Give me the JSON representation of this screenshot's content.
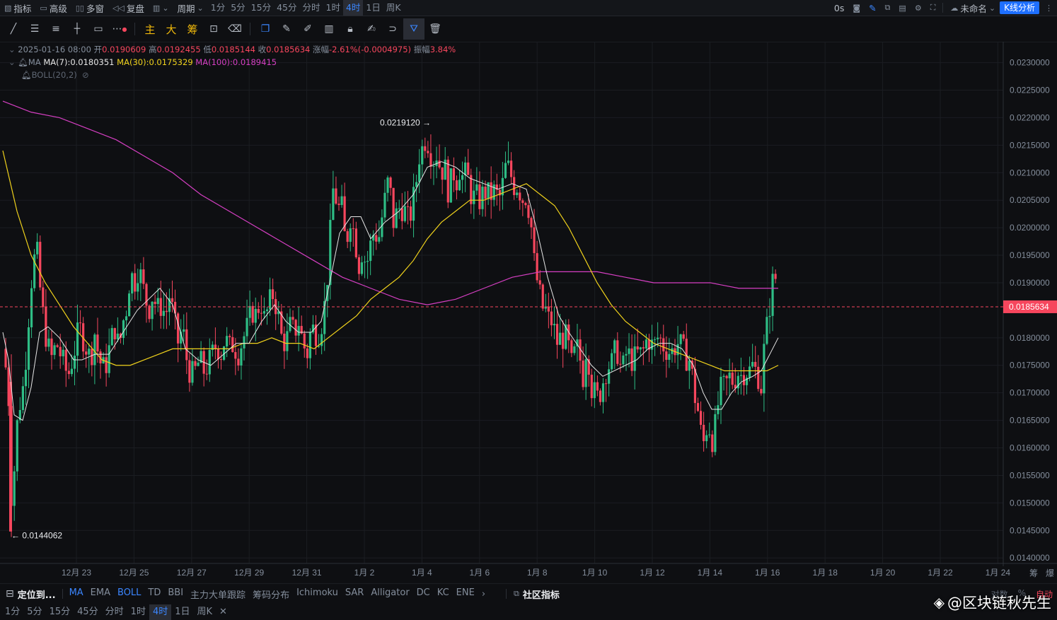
{
  "topbar": {
    "indicators": "指标",
    "advanced": "高级",
    "multi_window": "多窗",
    "replay": "复盘",
    "period": "周期",
    "timeframes": [
      "1分",
      "5分",
      "15分",
      "45分",
      "分时",
      "1时",
      "4时",
      "1日",
      "周K"
    ],
    "active_timeframe": "4时",
    "countdown": "0s",
    "layout_name": "未命名",
    "kline_analysis": "K线分析"
  },
  "info": {
    "date": "2025-01-16 08:00",
    "open_label": "开",
    "open": "0.0190609",
    "high_label": "高",
    "high": "0.0192455",
    "low_label": "低",
    "low": "0.0185144",
    "close_label": "收",
    "close": "0.0185634",
    "change_label": "涨幅",
    "change": "-2.61%(-0.0004975)",
    "amplitude_label": "振幅",
    "amplitude": "3.84%",
    "ma_label": "MA",
    "ma7": "MA(7):0.0180351",
    "ma30": "MA(30):0.0175329",
    "ma100": "MA(100):0.0189415",
    "boll": "BOLL(20,2)"
  },
  "chart_data": {
    "type": "candlestick",
    "y_ticks": [
      "0.0230000",
      "0.0225000",
      "0.0220000",
      "0.0215000",
      "0.0210000",
      "0.0205000",
      "0.0200000",
      "0.0195000",
      "0.0190000",
      "0.0180000",
      "0.0175000",
      "0.0170000",
      "0.0165000",
      "0.0160000",
      "0.0155000",
      "0.0150000",
      "0.0145000",
      "0.0140000"
    ],
    "ylim": [
      0.0139,
      0.0232
    ],
    "x_ticks": [
      "12月 23",
      "12月 25",
      "12月 27",
      "12月 29",
      "12月 31",
      "1月 2",
      "1月 4",
      "1月 6",
      "1月 8",
      "1月 10",
      "1月 12",
      "1月 14",
      "1月 16",
      "1月 18",
      "1月 20",
      "1月 22",
      "1月 24"
    ],
    "last_price": "0.0185634",
    "max_label": "0.0219120",
    "min_label": "0.0144062",
    "colors": {
      "up": "#2ebd85",
      "down": "#f6465d",
      "ma7": "#e6e6e6",
      "ma30": "#f0d21c",
      "ma100": "#d63fc3"
    },
    "close_path": [
      [
        0,
        0.0178
      ],
      [
        6,
        0.0173
      ],
      [
        10,
        0.0165
      ],
      [
        13,
        0.0146
      ],
      [
        18,
        0.0162
      ],
      [
        24,
        0.0168
      ],
      [
        30,
        0.0172
      ],
      [
        36,
        0.0183
      ],
      [
        42,
        0.0193
      ],
      [
        48,
        0.0196
      ],
      [
        54,
        0.0187
      ],
      [
        60,
        0.0181
      ],
      [
        68,
        0.0176
      ],
      [
        76,
        0.0179
      ],
      [
        84,
        0.0176
      ],
      [
        92,
        0.0173
      ],
      [
        100,
        0.0177
      ],
      [
        108,
        0.0182
      ],
      [
        116,
        0.0179
      ],
      [
        124,
        0.0176
      ],
      [
        130,
        0.0181
      ],
      [
        136,
        0.0176
      ],
      [
        144,
        0.0174
      ],
      [
        152,
        0.0179
      ],
      [
        158,
        0.0182
      ],
      [
        164,
        0.0178
      ],
      [
        170,
        0.0183
      ],
      [
        176,
        0.0186
      ],
      [
        180,
        0.0192
      ],
      [
        186,
        0.019
      ],
      [
        192,
        0.0193
      ],
      [
        200,
        0.0188
      ],
      [
        206,
        0.0185
      ],
      [
        212,
        0.0188
      ],
      [
        218,
        0.0185
      ],
      [
        224,
        0.0186
      ],
      [
        230,
        0.0184
      ],
      [
        236,
        0.0188
      ],
      [
        242,
        0.0183
      ],
      [
        248,
        0.0179
      ],
      [
        254,
        0.0182
      ],
      [
        260,
        0.0176
      ],
      [
        266,
        0.0173
      ],
      [
        272,
        0.0174
      ],
      [
        278,
        0.0176
      ],
      [
        284,
        0.0174
      ],
      [
        290,
        0.0175
      ],
      [
        296,
        0.0177
      ],
      [
        302,
        0.0179
      ],
      [
        308,
        0.0177
      ],
      [
        314,
        0.018
      ],
      [
        320,
        0.0178
      ],
      [
        326,
        0.0179
      ],
      [
        332,
        0.0177
      ],
      [
        340,
        0.018
      ],
      [
        346,
        0.0182
      ],
      [
        352,
        0.0185
      ],
      [
        358,
        0.0184
      ],
      [
        364,
        0.0187
      ],
      [
        370,
        0.0183
      ],
      [
        376,
        0.0186
      ],
      [
        382,
        0.0188
      ],
      [
        388,
        0.0185
      ],
      [
        394,
        0.018
      ],
      [
        400,
        0.0179
      ],
      [
        406,
        0.0182
      ],
      [
        412,
        0.0181
      ],
      [
        418,
        0.0183
      ],
      [
        424,
        0.0179
      ],
      [
        430,
        0.0177
      ],
      [
        436,
        0.0182
      ],
      [
        442,
        0.0181
      ],
      [
        448,
        0.0181
      ],
      [
        454,
        0.0185
      ],
      [
        458,
        0.019
      ],
      [
        462,
        0.0197
      ],
      [
        466,
        0.0207
      ],
      [
        470,
        0.0206
      ],
      [
        474,
        0.0203
      ],
      [
        478,
        0.0205
      ],
      [
        482,
        0.0199
      ],
      [
        486,
        0.0197
      ],
      [
        490,
        0.0203
      ],
      [
        494,
        0.02
      ],
      [
        498,
        0.0199
      ],
      [
        502,
        0.0192
      ],
      [
        506,
        0.0196
      ],
      [
        510,
        0.0195
      ],
      [
        514,
        0.0193
      ],
      [
        518,
        0.0196
      ],
      [
        522,
        0.0198
      ],
      [
        526,
        0.02
      ],
      [
        530,
        0.0197
      ],
      [
        536,
        0.0202
      ],
      [
        540,
        0.0205
      ],
      [
        544,
        0.0208
      ],
      [
        548,
        0.0206
      ],
      [
        552,
        0.0201
      ],
      [
        558,
        0.0203
      ],
      [
        562,
        0.0204
      ],
      [
        568,
        0.0203
      ],
      [
        574,
        0.0201
      ],
      [
        580,
        0.0205
      ],
      [
        584,
        0.0208
      ],
      [
        588,
        0.0213
      ],
      [
        592,
        0.0214
      ],
      [
        596,
        0.0216
      ],
      [
        600,
        0.0216
      ],
      [
        604,
        0.0214
      ],
      [
        608,
        0.0212
      ],
      [
        612,
        0.0214
      ],
      [
        616,
        0.0212
      ],
      [
        620,
        0.021
      ],
      [
        624,
        0.0212
      ],
      [
        628,
        0.0207
      ],
      [
        632,
        0.0207
      ],
      [
        636,
        0.0211
      ],
      [
        640,
        0.0208
      ],
      [
        646,
        0.0211
      ],
      [
        650,
        0.0209
      ],
      [
        656,
        0.021
      ],
      [
        660,
        0.0207
      ],
      [
        664,
        0.0205
      ],
      [
        668,
        0.0206
      ],
      [
        672,
        0.0205
      ],
      [
        676,
        0.0205
      ],
      [
        680,
        0.0207
      ],
      [
        684,
        0.0206
      ],
      [
        688,
        0.0206
      ],
      [
        692,
        0.0206
      ],
      [
        696,
        0.0207
      ],
      [
        700,
        0.0205
      ],
      [
        704,
        0.0206
      ],
      [
        708,
        0.0209
      ],
      [
        712,
        0.0212
      ],
      [
        716,
        0.021
      ],
      [
        720,
        0.0209
      ],
      [
        724,
        0.0207
      ],
      [
        728,
        0.0208
      ],
      [
        732,
        0.0206
      ],
      [
        736,
        0.0205
      ],
      [
        740,
        0.0206
      ],
      [
        744,
        0.0203
      ],
      [
        748,
        0.0199
      ],
      [
        752,
        0.0192
      ],
      [
        756,
        0.019
      ],
      [
        760,
        0.0187
      ],
      [
        764,
        0.0185
      ],
      [
        768,
        0.0185
      ],
      [
        772,
        0.0183
      ],
      [
        776,
        0.0183
      ],
      [
        780,
        0.0181
      ],
      [
        784,
        0.0179
      ],
      [
        788,
        0.018
      ],
      [
        792,
        0.018
      ],
      [
        796,
        0.018
      ],
      [
        800,
        0.0178
      ],
      [
        804,
        0.0175
      ],
      [
        808,
        0.0177
      ],
      [
        812,
        0.0178
      ],
      [
        816,
        0.0176
      ],
      [
        820,
        0.0173
      ],
      [
        824,
        0.0178
      ],
      [
        828,
        0.0176
      ],
      [
        832,
        0.0171
      ],
      [
        836,
        0.017
      ],
      [
        840,
        0.0169
      ],
      [
        844,
        0.017
      ],
      [
        848,
        0.0172
      ],
      [
        852,
        0.0174
      ],
      [
        856,
        0.0175
      ],
      [
        860,
        0.0175
      ],
      [
        864,
        0.0177
      ],
      [
        868,
        0.0178
      ],
      [
        872,
        0.0175
      ],
      [
        876,
        0.0174
      ],
      [
        880,
        0.0177
      ],
      [
        884,
        0.0177
      ],
      [
        888,
        0.0176
      ],
      [
        892,
        0.0176
      ],
      [
        896,
        0.0177
      ],
      [
        900,
        0.0177
      ],
      [
        904,
        0.0177
      ],
      [
        908,
        0.0179
      ],
      [
        912,
        0.018
      ],
      [
        916,
        0.0179
      ],
      [
        920,
        0.0178
      ],
      [
        924,
        0.018
      ],
      [
        928,
        0.018
      ],
      [
        932,
        0.0179
      ],
      [
        936,
        0.0178
      ],
      [
        940,
        0.0178
      ],
      [
        944,
        0.0177
      ],
      [
        948,
        0.0178
      ],
      [
        952,
        0.0179
      ],
      [
        956,
        0.0179
      ],
      [
        960,
        0.0178
      ],
      [
        964,
        0.0177
      ],
      [
        968,
        0.0176
      ],
      [
        972,
        0.0176
      ],
      [
        976,
        0.0171
      ],
      [
        980,
        0.0168
      ],
      [
        984,
        0.0166
      ],
      [
        988,
        0.0161
      ],
      [
        992,
        0.0161
      ],
      [
        996,
        0.0165
      ],
      [
        1000,
        0.0163
      ],
      [
        1004,
        0.0161
      ],
      [
        1008,
        0.0165
      ],
      [
        1012,
        0.0169
      ],
      [
        1016,
        0.0171
      ],
      [
        1020,
        0.0171
      ],
      [
        1024,
        0.0172
      ],
      [
        1028,
        0.0173
      ],
      [
        1032,
        0.0172
      ],
      [
        1036,
        0.0173
      ],
      [
        1040,
        0.0174
      ],
      [
        1044,
        0.0173
      ],
      [
        1048,
        0.0174
      ],
      [
        1052,
        0.0174
      ],
      [
        1056,
        0.0174
      ],
      [
        1060,
        0.0175
      ],
      [
        1064,
        0.0174
      ],
      [
        1068,
        0.0173
      ],
      [
        1072,
        0.0171
      ],
      [
        1076,
        0.0178
      ],
      [
        1080,
        0.0182
      ],
      [
        1084,
        0.0186
      ],
      [
        1088,
        0.019
      ],
      [
        1092,
        0.0191
      ],
      [
        1096,
        0.0186
      ]
    ],
    "ma7_path": [
      [
        0,
        0.0181
      ],
      [
        8,
        0.0176
      ],
      [
        16,
        0.0166
      ],
      [
        28,
        0.0165
      ],
      [
        40,
        0.0171
      ],
      [
        52,
        0.0181
      ],
      [
        64,
        0.0182
      ],
      [
        80,
        0.018
      ],
      [
        100,
        0.0176
      ],
      [
        112,
        0.0176
      ],
      [
        130,
        0.0177
      ],
      [
        150,
        0.0177
      ],
      [
        170,
        0.0181
      ],
      [
        190,
        0.0185
      ],
      [
        206,
        0.0187
      ],
      [
        222,
        0.0189
      ],
      [
        240,
        0.0186
      ],
      [
        258,
        0.0178
      ],
      [
        276,
        0.0176
      ],
      [
        294,
        0.0175
      ],
      [
        312,
        0.0177
      ],
      [
        330,
        0.0179
      ],
      [
        348,
        0.0179
      ],
      [
        366,
        0.0183
      ],
      [
        384,
        0.0186
      ],
      [
        400,
        0.0183
      ],
      [
        418,
        0.0181
      ],
      [
        436,
        0.0181
      ],
      [
        450,
        0.0183
      ],
      [
        462,
        0.019
      ],
      [
        476,
        0.0199
      ],
      [
        492,
        0.0202
      ],
      [
        506,
        0.0202
      ],
      [
        520,
        0.0198
      ],
      [
        540,
        0.0201
      ],
      [
        560,
        0.0203
      ],
      [
        580,
        0.0206
      ],
      [
        600,
        0.0211
      ],
      [
        620,
        0.0212
      ],
      [
        640,
        0.0211
      ],
      [
        660,
        0.0209
      ],
      [
        680,
        0.0208
      ],
      [
        700,
        0.0207
      ],
      [
        720,
        0.0208
      ],
      [
        740,
        0.0207
      ],
      [
        756,
        0.0199
      ],
      [
        770,
        0.0191
      ],
      [
        786,
        0.0184
      ],
      [
        800,
        0.0181
      ],
      [
        816,
        0.0178
      ],
      [
        832,
        0.0175
      ],
      [
        848,
        0.0173
      ],
      [
        864,
        0.0174
      ],
      [
        880,
        0.0175
      ],
      [
        896,
        0.0176
      ],
      [
        912,
        0.0178
      ],
      [
        928,
        0.0179
      ],
      [
        944,
        0.0179
      ],
      [
        960,
        0.0178
      ],
      [
        976,
        0.0175
      ],
      [
        990,
        0.017
      ],
      [
        1002,
        0.0167
      ],
      [
        1016,
        0.0167
      ],
      [
        1030,
        0.017
      ],
      [
        1044,
        0.0172
      ],
      [
        1060,
        0.0173
      ],
      [
        1072,
        0.0174
      ],
      [
        1084,
        0.0177
      ],
      [
        1096,
        0.018
      ]
    ],
    "ma30_path": [
      [
        0,
        0.0214
      ],
      [
        20,
        0.0203
      ],
      [
        40,
        0.0195
      ],
      [
        60,
        0.019
      ],
      [
        80,
        0.0186
      ],
      [
        100,
        0.0182
      ],
      [
        120,
        0.0179
      ],
      [
        140,
        0.0176
      ],
      [
        160,
        0.0175
      ],
      [
        180,
        0.0175
      ],
      [
        200,
        0.0176
      ],
      [
        220,
        0.0177
      ],
      [
        240,
        0.0178
      ],
      [
        260,
        0.0178
      ],
      [
        280,
        0.0178
      ],
      [
        300,
        0.0178
      ],
      [
        320,
        0.0178
      ],
      [
        340,
        0.0179
      ],
      [
        360,
        0.0179
      ],
      [
        380,
        0.018
      ],
      [
        400,
        0.0179
      ],
      [
        420,
        0.0179
      ],
      [
        440,
        0.0178
      ],
      [
        460,
        0.018
      ],
      [
        480,
        0.0182
      ],
      [
        500,
        0.0184
      ],
      [
        520,
        0.0187
      ],
      [
        540,
        0.0189
      ],
      [
        560,
        0.0191
      ],
      [
        580,
        0.0194
      ],
      [
        600,
        0.0198
      ],
      [
        620,
        0.0201
      ],
      [
        640,
        0.0203
      ],
      [
        660,
        0.0205
      ],
      [
        680,
        0.0205
      ],
      [
        700,
        0.0206
      ],
      [
        720,
        0.0207
      ],
      [
        740,
        0.0208
      ],
      [
        760,
        0.0206
      ],
      [
        780,
        0.0204
      ],
      [
        800,
        0.02
      ],
      [
        820,
        0.0195
      ],
      [
        840,
        0.019
      ],
      [
        860,
        0.0186
      ],
      [
        880,
        0.0183
      ],
      [
        900,
        0.0181
      ],
      [
        920,
        0.0179
      ],
      [
        940,
        0.0178
      ],
      [
        960,
        0.0177
      ],
      [
        980,
        0.0176
      ],
      [
        1000,
        0.0175
      ],
      [
        1020,
        0.0174
      ],
      [
        1040,
        0.0174
      ],
      [
        1060,
        0.0174
      ],
      [
        1080,
        0.0174
      ],
      [
        1096,
        0.0175
      ]
    ],
    "ma100_path": [
      [
        0,
        0.0223
      ],
      [
        40,
        0.0221
      ],
      [
        80,
        0.022
      ],
      [
        120,
        0.0218
      ],
      [
        160,
        0.0216
      ],
      [
        200,
        0.0213
      ],
      [
        240,
        0.021
      ],
      [
        280,
        0.0206
      ],
      [
        320,
        0.0203
      ],
      [
        360,
        0.02
      ],
      [
        400,
        0.0197
      ],
      [
        440,
        0.0194
      ],
      [
        480,
        0.0191
      ],
      [
        520,
        0.0189
      ],
      [
        560,
        0.0187
      ],
      [
        600,
        0.0186
      ],
      [
        640,
        0.0187
      ],
      [
        680,
        0.0189
      ],
      [
        720,
        0.0191
      ],
      [
        760,
        0.0192
      ],
      [
        800,
        0.0192
      ],
      [
        840,
        0.0192
      ],
      [
        880,
        0.0191
      ],
      [
        920,
        0.019
      ],
      [
        960,
        0.019
      ],
      [
        1000,
        0.019
      ],
      [
        1040,
        0.0189
      ],
      [
        1080,
        0.0189
      ],
      [
        1096,
        0.0189
      ]
    ]
  },
  "indicator_tabs": {
    "locate": "定位到...",
    "items": [
      "MA",
      "EMA",
      "BOLL",
      "TD",
      "BBI",
      "主力大单跟踪",
      "筹码分布",
      "Ichimoku",
      "SAR",
      "Alligator",
      "DC",
      "KC",
      "ENE"
    ],
    "community": "社区指标",
    "log_label": "对数",
    "pct_label": "%",
    "auto_label": "自动"
  },
  "bottom_timeframes": [
    "1分",
    "5分",
    "15分",
    "45分",
    "分时",
    "1时",
    "4时",
    "1日",
    "周K"
  ],
  "bottom_active": "4时",
  "axis_corner": [
    "筹",
    "爆"
  ],
  "watermark": "@区块链秋先生"
}
